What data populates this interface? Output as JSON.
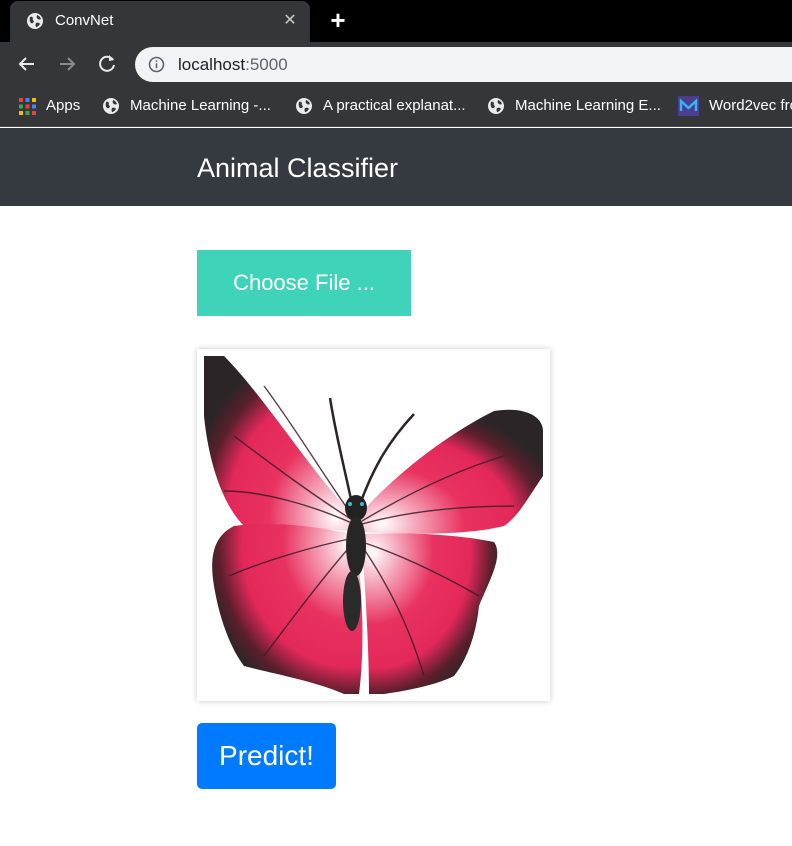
{
  "browser": {
    "tab_title": "ConvNet",
    "url_host": "localhost",
    "url_port": ":5000",
    "bookmarks": [
      {
        "label": "Apps",
        "icon": "apps-grid-icon"
      },
      {
        "label": "Machine Learning -...",
        "icon": "globe-icon"
      },
      {
        "label": "A practical explanat...",
        "icon": "globe-icon"
      },
      {
        "label": "Machine Learning E...",
        "icon": "globe-icon"
      },
      {
        "label": "Word2vec fro",
        "icon": "medium-logo-icon"
      }
    ]
  },
  "page": {
    "brand": "Animal Classifier",
    "choose_file_label": "Choose File ...",
    "predict_label": "Predict!",
    "preview_image": "butterfly-image"
  },
  "colors": {
    "navbar": "#343a40",
    "choose_button": "#3fd3b9",
    "predict_button": "#007bff"
  }
}
